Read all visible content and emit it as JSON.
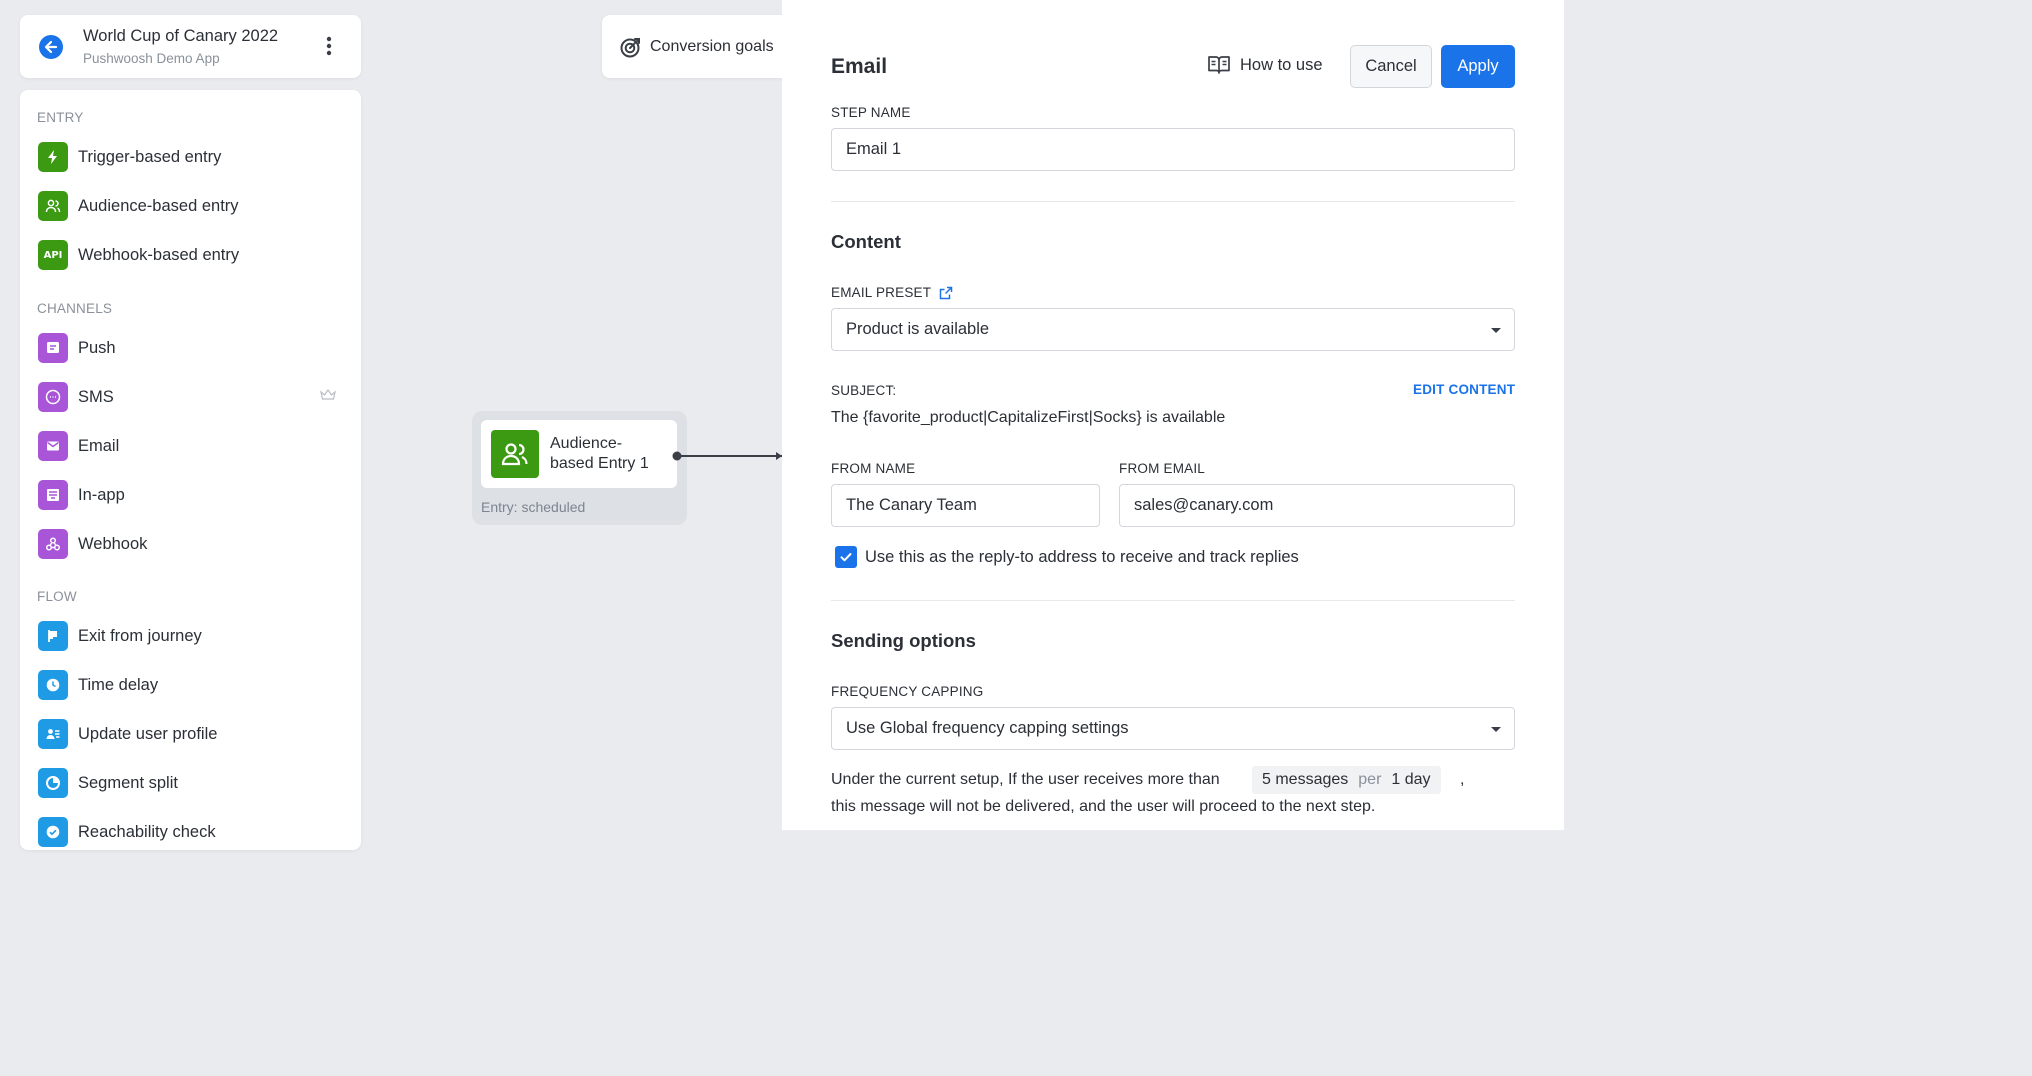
{
  "app": {
    "title": "World Cup of Canary 2022",
    "subtitle": "Pushwoosh Demo App"
  },
  "palette": {
    "entry_label": "ENTRY",
    "entry": [
      "Trigger-based entry",
      "Audience-based entry",
      "Webhook-based entry"
    ],
    "channels_label": "CHANNELS",
    "channels": [
      "Push",
      "SMS",
      "Email",
      "In-app",
      "Webhook"
    ],
    "flow_label": "FLOW",
    "flow": [
      "Exit from journey",
      "Time delay",
      "Update user profile",
      "Segment split",
      "Reachability check"
    ],
    "webhook_badge": "API"
  },
  "canvas": {
    "goals_label": "Conversion goals",
    "node": {
      "title_line1": "Audience-",
      "title_line2": "based Entry 1",
      "subtitle": "Entry: scheduled"
    }
  },
  "panel": {
    "title": "Email",
    "how_to_use": "How to use",
    "cancel": "Cancel",
    "apply": "Apply",
    "step_name_label": "STEP NAME",
    "step_name_value": "Email 1",
    "content_heading": "Content",
    "email_preset_label": "EMAIL PRESET",
    "email_preset_value": "Product is available",
    "subject_label": "SUBJECT:",
    "edit_content": "EDIT CONTENT",
    "subject_value": "The {favorite_product|CapitalizeFirst|Socks} is available",
    "from_name_label": "FROM NAME",
    "from_name_value": "The Canary Team",
    "from_email_label": "FROM EMAIL",
    "from_email_value": "sales@canary.com",
    "reply_to_checked": true,
    "reply_to_label": "Use this as the reply-to address to receive and track replies",
    "sending_heading": "Sending options",
    "freq_label": "FREQUENCY CAPPING",
    "freq_value": "Use Global frequency capping settings",
    "note_line1": "Under the current setup, If the user receives more than",
    "cap_messages": "5 messages",
    "cap_per": "per",
    "cap_period": "1 day",
    "note_comma": ",",
    "note_line2": "this message will not be delivered, and the user will proceed to the next step."
  },
  "colors": {
    "accent": "#1a73e8",
    "entry": "#3b9a12",
    "channel": "#a855d8",
    "flow": "#1f9be6"
  }
}
